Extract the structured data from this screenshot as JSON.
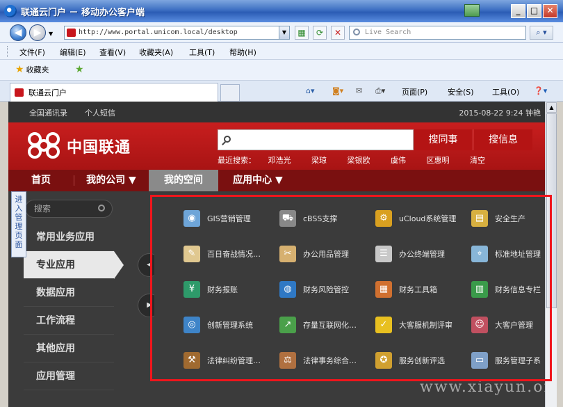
{
  "window": {
    "title": "联通云门户 － 移动办公客户端"
  },
  "address": {
    "url": "http://www.portal.unicom.local/desktop",
    "search_placeholder": "Live Search"
  },
  "menu": [
    "文件(F)",
    "编辑(E)",
    "查看(V)",
    "收藏夹(A)",
    "工具(T)",
    "帮助(H)"
  ],
  "favorites": {
    "label": "收藏夹"
  },
  "tab": {
    "title": "联通云门户"
  },
  "commands": {
    "page": "页面(P)",
    "safety": "安全(S)",
    "tools": "工具(O)"
  },
  "page": {
    "top_links": [
      "全国通讯录",
      "个人短信"
    ],
    "clock": "2015-08-22 9:24 钟艳",
    "logo_text": "中国联通",
    "search": {
      "btn_people": "搜同事",
      "btn_info": "搜信息"
    },
    "recent_label": "最近搜索：",
    "recent": [
      "邓浩光",
      "梁琼",
      "梁银欧",
      "虞伟",
      "区惠明",
      "清空"
    ],
    "nav": [
      "首页",
      "我的公司 ▼",
      "我的空间",
      "应用中心 ▼"
    ],
    "side_search": "搜索",
    "side_items": [
      "常用业务应用",
      "专业应用",
      "数据应用",
      "工作流程",
      "其他应用",
      "应用管理"
    ],
    "vert_tab": "进入管理页面",
    "apps": [
      {
        "label": "GIS营销管理",
        "icon": "globe-screen-icon",
        "color": "#6ea5d8"
      },
      {
        "label": "cBSS支撑",
        "icon": "cart-icon",
        "color": "#888888"
      },
      {
        "label": "uCloud系统管理",
        "icon": "gears-icon",
        "color": "#d9a020"
      },
      {
        "label": "安全生产",
        "icon": "board-icon",
        "color": "#d8b040"
      },
      {
        "label": "百日奋战情况…",
        "icon": "notepad-icon",
        "color": "#e0c890"
      },
      {
        "label": "办公用品管理",
        "icon": "tools-icon",
        "color": "#d6b070"
      },
      {
        "label": "办公终端管理",
        "icon": "document-icon",
        "color": "#c8c8c8"
      },
      {
        "label": "标准地址管理",
        "icon": "map-icon",
        "color": "#88b6d8"
      },
      {
        "label": "财务报账",
        "icon": "yen-icon",
        "color": "#2e9a6a"
      },
      {
        "label": "财务风险管控",
        "icon": "globe-icon",
        "color": "#2f78c4"
      },
      {
        "label": "财务工具箱",
        "icon": "calculator-icon",
        "color": "#d07030"
      },
      {
        "label": "财务信息专栏",
        "icon": "bar-chart-icon",
        "color": "#3a9a4a"
      },
      {
        "label": "创新管理系统",
        "icon": "globe-blue-icon",
        "color": "#3e84c8"
      },
      {
        "label": "存量互联网化…",
        "icon": "growth-chart-icon",
        "color": "#4aa04a"
      },
      {
        "label": "大客服机制评审",
        "icon": "checkmark-icon",
        "color": "#e8c020"
      },
      {
        "label": "大客户管理",
        "icon": "people-icon",
        "color": "#c05060"
      },
      {
        "label": "法律纠纷管理…",
        "icon": "gavel-icon",
        "color": "#a06a30"
      },
      {
        "label": "法律事务综合…",
        "icon": "law-book-icon",
        "color": "#b07040"
      },
      {
        "label": "服务创新评选",
        "icon": "medal-icon",
        "color": "#d0a030"
      },
      {
        "label": "服务管理子系",
        "icon": "form-icon",
        "color": "#7fa0c8"
      }
    ],
    "watermark": "www.xiayun.org"
  }
}
